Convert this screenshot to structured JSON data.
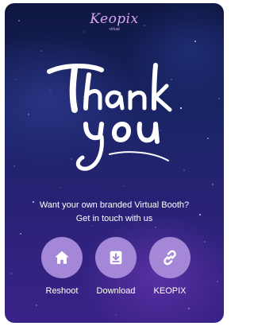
{
  "brand": {
    "name": "Keopix",
    "tagline": "virtual"
  },
  "hero": {
    "text": "Thank you"
  },
  "promo": {
    "line1": "Want your own branded Virtual Booth?",
    "line2": "Get in touch with us"
  },
  "actions": [
    {
      "label": "Reshoot",
      "icon": "home-icon"
    },
    {
      "label": "Download",
      "icon": "download-icon"
    },
    {
      "label": "KEOPIX",
      "icon": "link-icon"
    }
  ],
  "colors": {
    "button": "#a487d6",
    "text": "#ffffff",
    "background": "#1a2566"
  }
}
